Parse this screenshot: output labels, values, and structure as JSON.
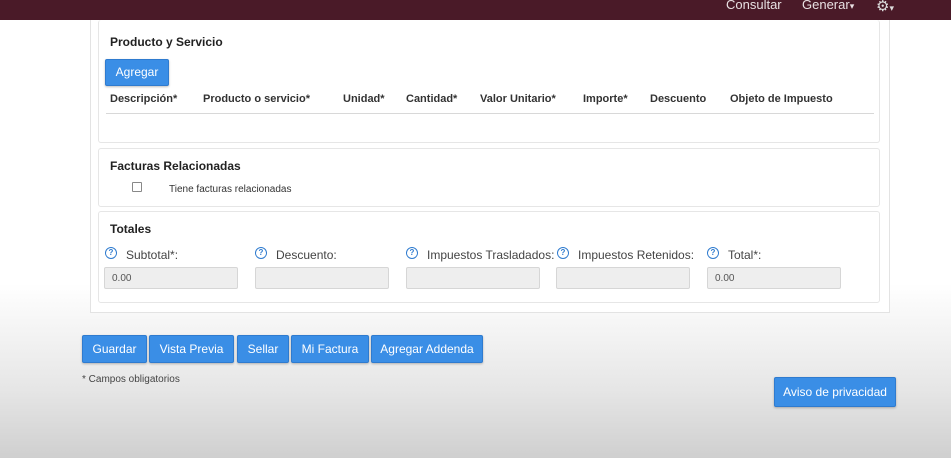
{
  "topnav": {
    "consultar": "Consultar",
    "generar": "Generar",
    "generar_caret": "▾",
    "settings_caret": "▾"
  },
  "producto": {
    "title": "Producto y Servicio",
    "add_button": "Agregar",
    "columns": [
      "Descripción*",
      "Producto o servicio*",
      "Unidad*",
      "Cantidad*",
      "Valor Unitario*",
      "Importe*",
      "Descuento",
      "Objeto de Impuesto"
    ]
  },
  "facturas": {
    "title": "Facturas Relacionadas",
    "checkbox_label": "Tiene facturas relacionadas",
    "checked": false
  },
  "totales": {
    "title": "Totales",
    "fields": [
      {
        "label": "Subtotal*:",
        "value": "0.00"
      },
      {
        "label": "Descuento:",
        "value": ""
      },
      {
        "label": "Impuestos Trasladados:",
        "value": ""
      },
      {
        "label": "Impuestos Retenidos:",
        "value": ""
      },
      {
        "label": "Total*:",
        "value": "0.00"
      }
    ],
    "help_glyph": "?"
  },
  "actions": {
    "guardar": "Guardar",
    "vista_previa": "Vista Previa",
    "sellar": "Sellar",
    "mi_factura": "Mi Factura",
    "agregar_addenda": "Agregar Addenda"
  },
  "footer": {
    "required_note": "* Campos obligatorios",
    "privacy_button": "Aviso de privacidad"
  },
  "colors": {
    "topbar": "#4a1a28",
    "button": "#3a8ee6"
  }
}
